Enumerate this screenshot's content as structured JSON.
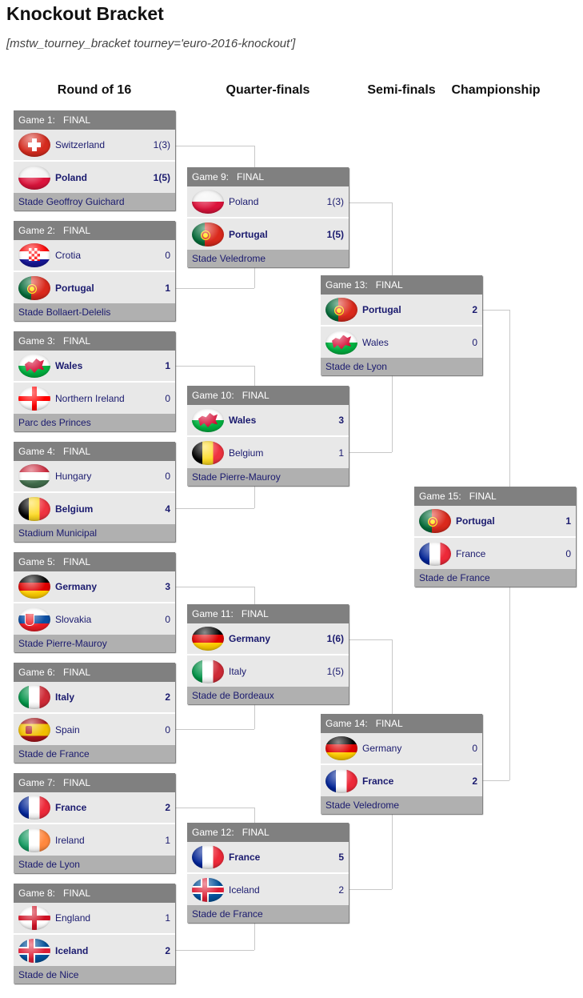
{
  "page": {
    "title": "Knockout Bracket",
    "shortcode": "[mstw_tourney_bracket tourney='euro-2016-knockout']"
  },
  "rounds": [
    "Round of 16",
    "Quarter-finals",
    "Semi-finals",
    "Championship"
  ],
  "games": [
    {
      "label": "Game 1:",
      "status": "FINAL",
      "venue": "Stade Geoffroy Guichard",
      "teams": [
        {
          "name": "Switzerland",
          "score": "1(3)",
          "flag": "switzerland-flag-icon",
          "winner": false
        },
        {
          "name": "Poland",
          "score": "1(5)",
          "flag": "poland-flag-icon",
          "winner": true
        }
      ]
    },
    {
      "label": "Game 2:",
      "status": "FINAL",
      "venue": "Stade Bollaert-Delelis",
      "teams": [
        {
          "name": "Crotia",
          "score": "0",
          "flag": "croatia-flag-icon",
          "winner": false
        },
        {
          "name": "Portugal",
          "score": "1",
          "flag": "portugal-flag-icon",
          "winner": true
        }
      ]
    },
    {
      "label": "Game 3:",
      "status": "FINAL",
      "venue": "Parc des Princes",
      "teams": [
        {
          "name": "Wales",
          "score": "1",
          "flag": "wales-flag-icon",
          "winner": true
        },
        {
          "name": "Northern Ireland",
          "score": "0",
          "flag": "northern-ireland-flag-icon",
          "winner": false
        }
      ]
    },
    {
      "label": "Game 4:",
      "status": "FINAL",
      "venue": "Stadium Municipal",
      "teams": [
        {
          "name": "Hungary",
          "score": "0",
          "flag": "hungary-flag-icon",
          "winner": false
        },
        {
          "name": "Belgium",
          "score": "4",
          "flag": "belgium-flag-icon",
          "winner": true
        }
      ]
    },
    {
      "label": "Game 5:",
      "status": "FINAL",
      "venue": "Stade Pierre-Mauroy",
      "teams": [
        {
          "name": "Germany",
          "score": "3",
          "flag": "germany-flag-icon",
          "winner": true
        },
        {
          "name": "Slovakia",
          "score": "0",
          "flag": "slovakia-flag-icon",
          "winner": false
        }
      ]
    },
    {
      "label": "Game 6:",
      "status": "FINAL",
      "venue": "Stade de France",
      "teams": [
        {
          "name": "Italy",
          "score": "2",
          "flag": "italy-flag-icon",
          "winner": true
        },
        {
          "name": "Spain",
          "score": "0",
          "flag": "spain-flag-icon",
          "winner": false
        }
      ]
    },
    {
      "label": "Game 7:",
      "status": "FINAL",
      "venue": "Stade de Lyon",
      "teams": [
        {
          "name": "France",
          "score": "2",
          "flag": "france-flag-icon",
          "winner": true
        },
        {
          "name": "Ireland",
          "score": "1",
          "flag": "ireland-flag-icon",
          "winner": false
        }
      ]
    },
    {
      "label": "Game 8:",
      "status": "FINAL",
      "venue": "Stade de Nice",
      "teams": [
        {
          "name": "England",
          "score": "1",
          "flag": "england-flag-icon",
          "winner": false
        },
        {
          "name": "Iceland",
          "score": "2",
          "flag": "iceland-flag-icon",
          "winner": true
        }
      ]
    },
    {
      "label": "Game 9:",
      "status": "FINAL",
      "venue": "Stade Veledrome",
      "teams": [
        {
          "name": "Poland",
          "score": "1(3)",
          "flag": "poland-flag-icon",
          "winner": false
        },
        {
          "name": "Portugal",
          "score": "1(5)",
          "flag": "portugal-flag-icon",
          "winner": true
        }
      ]
    },
    {
      "label": "Game 10:",
      "status": "FINAL",
      "venue": "Stade Pierre-Mauroy",
      "teams": [
        {
          "name": "Wales",
          "score": "3",
          "flag": "wales-flag-icon",
          "winner": true
        },
        {
          "name": "Belgium",
          "score": "1",
          "flag": "belgium-flag-icon",
          "winner": false
        }
      ]
    },
    {
      "label": "Game 11:",
      "status": "FINAL",
      "venue": "Stade de Bordeaux",
      "teams": [
        {
          "name": "Germany",
          "score": "1(6)",
          "flag": "germany-flag-icon",
          "winner": true
        },
        {
          "name": "Italy",
          "score": "1(5)",
          "flag": "italy-flag-icon",
          "winner": false
        }
      ]
    },
    {
      "label": "Game 12:",
      "status": "FINAL",
      "venue": "Stade de France",
      "teams": [
        {
          "name": "France",
          "score": "5",
          "flag": "france-flag-icon",
          "winner": true
        },
        {
          "name": "Iceland",
          "score": "2",
          "flag": "iceland-flag-icon",
          "winner": false
        }
      ]
    },
    {
      "label": "Game 13:",
      "status": "FINAL",
      "venue": "Stade de Lyon",
      "teams": [
        {
          "name": "Portugal",
          "score": "2",
          "flag": "portugal-flag-icon",
          "winner": true
        },
        {
          "name": "Wales",
          "score": "0",
          "flag": "wales-flag-icon",
          "winner": false
        }
      ]
    },
    {
      "label": "Game 14:",
      "status": "FINAL",
      "venue": "Stade Veledrome",
      "teams": [
        {
          "name": "Germany",
          "score": "0",
          "flag": "germany-flag-icon",
          "winner": false
        },
        {
          "name": "France",
          "score": "2",
          "flag": "france-flag-icon",
          "winner": true
        }
      ]
    },
    {
      "label": "Game 15:",
      "status": "FINAL",
      "venue": "Stade de France",
      "teams": [
        {
          "name": "Portugal",
          "score": "1",
          "flag": "portugal-flag-icon",
          "winner": true
        },
        {
          "name": "France",
          "score": "0",
          "flag": "france-flag-icon",
          "winner": false
        }
      ]
    }
  ],
  "colors": {
    "header_bg": "#808080",
    "row_bg": "#e8e8e8",
    "venue_bg": "#b0b0b0",
    "team_text": "#1a1a6e",
    "connector": "#c8c8c8"
  }
}
